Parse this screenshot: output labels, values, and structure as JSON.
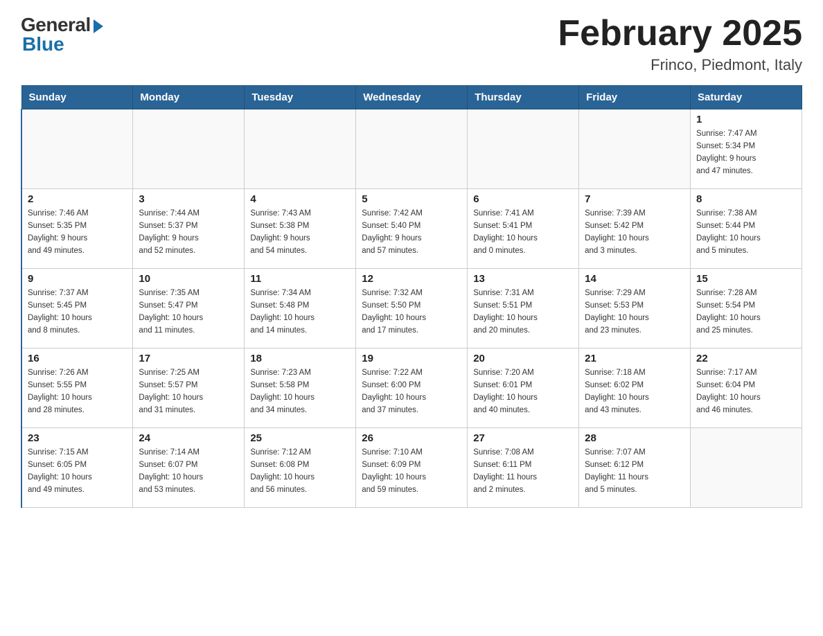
{
  "header": {
    "logo_general": "General",
    "logo_blue": "Blue",
    "month_title": "February 2025",
    "location": "Frinco, Piedmont, Italy"
  },
  "days_of_week": [
    "Sunday",
    "Monday",
    "Tuesday",
    "Wednesday",
    "Thursday",
    "Friday",
    "Saturday"
  ],
  "weeks": [
    [
      {
        "date": "",
        "info": ""
      },
      {
        "date": "",
        "info": ""
      },
      {
        "date": "",
        "info": ""
      },
      {
        "date": "",
        "info": ""
      },
      {
        "date": "",
        "info": ""
      },
      {
        "date": "",
        "info": ""
      },
      {
        "date": "1",
        "info": "Sunrise: 7:47 AM\nSunset: 5:34 PM\nDaylight: 9 hours\nand 47 minutes."
      }
    ],
    [
      {
        "date": "2",
        "info": "Sunrise: 7:46 AM\nSunset: 5:35 PM\nDaylight: 9 hours\nand 49 minutes."
      },
      {
        "date": "3",
        "info": "Sunrise: 7:44 AM\nSunset: 5:37 PM\nDaylight: 9 hours\nand 52 minutes."
      },
      {
        "date": "4",
        "info": "Sunrise: 7:43 AM\nSunset: 5:38 PM\nDaylight: 9 hours\nand 54 minutes."
      },
      {
        "date": "5",
        "info": "Sunrise: 7:42 AM\nSunset: 5:40 PM\nDaylight: 9 hours\nand 57 minutes."
      },
      {
        "date": "6",
        "info": "Sunrise: 7:41 AM\nSunset: 5:41 PM\nDaylight: 10 hours\nand 0 minutes."
      },
      {
        "date": "7",
        "info": "Sunrise: 7:39 AM\nSunset: 5:42 PM\nDaylight: 10 hours\nand 3 minutes."
      },
      {
        "date": "8",
        "info": "Sunrise: 7:38 AM\nSunset: 5:44 PM\nDaylight: 10 hours\nand 5 minutes."
      }
    ],
    [
      {
        "date": "9",
        "info": "Sunrise: 7:37 AM\nSunset: 5:45 PM\nDaylight: 10 hours\nand 8 minutes."
      },
      {
        "date": "10",
        "info": "Sunrise: 7:35 AM\nSunset: 5:47 PM\nDaylight: 10 hours\nand 11 minutes."
      },
      {
        "date": "11",
        "info": "Sunrise: 7:34 AM\nSunset: 5:48 PM\nDaylight: 10 hours\nand 14 minutes."
      },
      {
        "date": "12",
        "info": "Sunrise: 7:32 AM\nSunset: 5:50 PM\nDaylight: 10 hours\nand 17 minutes."
      },
      {
        "date": "13",
        "info": "Sunrise: 7:31 AM\nSunset: 5:51 PM\nDaylight: 10 hours\nand 20 minutes."
      },
      {
        "date": "14",
        "info": "Sunrise: 7:29 AM\nSunset: 5:53 PM\nDaylight: 10 hours\nand 23 minutes."
      },
      {
        "date": "15",
        "info": "Sunrise: 7:28 AM\nSunset: 5:54 PM\nDaylight: 10 hours\nand 25 minutes."
      }
    ],
    [
      {
        "date": "16",
        "info": "Sunrise: 7:26 AM\nSunset: 5:55 PM\nDaylight: 10 hours\nand 28 minutes."
      },
      {
        "date": "17",
        "info": "Sunrise: 7:25 AM\nSunset: 5:57 PM\nDaylight: 10 hours\nand 31 minutes."
      },
      {
        "date": "18",
        "info": "Sunrise: 7:23 AM\nSunset: 5:58 PM\nDaylight: 10 hours\nand 34 minutes."
      },
      {
        "date": "19",
        "info": "Sunrise: 7:22 AM\nSunset: 6:00 PM\nDaylight: 10 hours\nand 37 minutes."
      },
      {
        "date": "20",
        "info": "Sunrise: 7:20 AM\nSunset: 6:01 PM\nDaylight: 10 hours\nand 40 minutes."
      },
      {
        "date": "21",
        "info": "Sunrise: 7:18 AM\nSunset: 6:02 PM\nDaylight: 10 hours\nand 43 minutes."
      },
      {
        "date": "22",
        "info": "Sunrise: 7:17 AM\nSunset: 6:04 PM\nDaylight: 10 hours\nand 46 minutes."
      }
    ],
    [
      {
        "date": "23",
        "info": "Sunrise: 7:15 AM\nSunset: 6:05 PM\nDaylight: 10 hours\nand 49 minutes."
      },
      {
        "date": "24",
        "info": "Sunrise: 7:14 AM\nSunset: 6:07 PM\nDaylight: 10 hours\nand 53 minutes."
      },
      {
        "date": "25",
        "info": "Sunrise: 7:12 AM\nSunset: 6:08 PM\nDaylight: 10 hours\nand 56 minutes."
      },
      {
        "date": "26",
        "info": "Sunrise: 7:10 AM\nSunset: 6:09 PM\nDaylight: 10 hours\nand 59 minutes."
      },
      {
        "date": "27",
        "info": "Sunrise: 7:08 AM\nSunset: 6:11 PM\nDaylight: 11 hours\nand 2 minutes."
      },
      {
        "date": "28",
        "info": "Sunrise: 7:07 AM\nSunset: 6:12 PM\nDaylight: 11 hours\nand 5 minutes."
      },
      {
        "date": "",
        "info": ""
      }
    ]
  ]
}
